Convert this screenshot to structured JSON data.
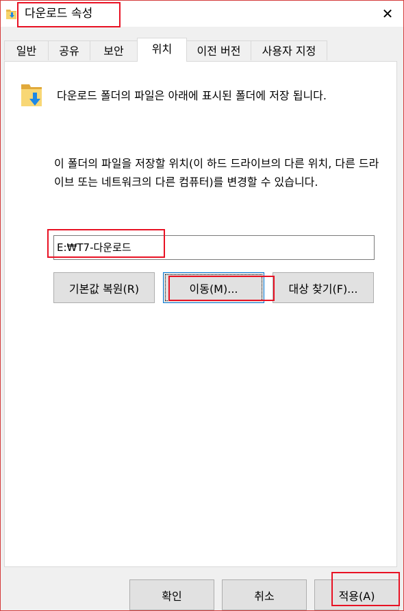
{
  "window": {
    "title": "다운로드 속성",
    "close_glyph": "✕"
  },
  "tabs": [
    {
      "label": "일반",
      "active": false
    },
    {
      "label": "공유",
      "active": false
    },
    {
      "label": "보안",
      "active": false
    },
    {
      "label": "위치",
      "active": true
    },
    {
      "label": "이전 버전",
      "active": false
    },
    {
      "label": "사용자 지정",
      "active": false
    }
  ],
  "location": {
    "description": "다운로드 폴더의 파일은 아래에 표시된 폴더에 저장 됩니다.",
    "info": "이 폴더의 파일을 저장할 위치(이 하드 드라이브의 다른 위치, 다른 드라이브 또는 네트워크의 다른 컴퓨터)를 변경할 수 있습니다.",
    "path_value": "E:₩T7-다운로드",
    "restore_default_label": "기본값 복원(R)",
    "move_label": "이동(M)...",
    "find_target_label": "대상 찾기(F)..."
  },
  "footer": {
    "ok_label": "확인",
    "cancel_label": "취소",
    "apply_label": "적용(A)"
  },
  "colors": {
    "annotation": "#e81123",
    "focus": "#0078d7",
    "folder": "#e8b84a",
    "arrow": "#1e88e5"
  },
  "icons": {
    "title": "folder-download-icon",
    "close": "close-icon",
    "location": "folder-download-icon"
  }
}
